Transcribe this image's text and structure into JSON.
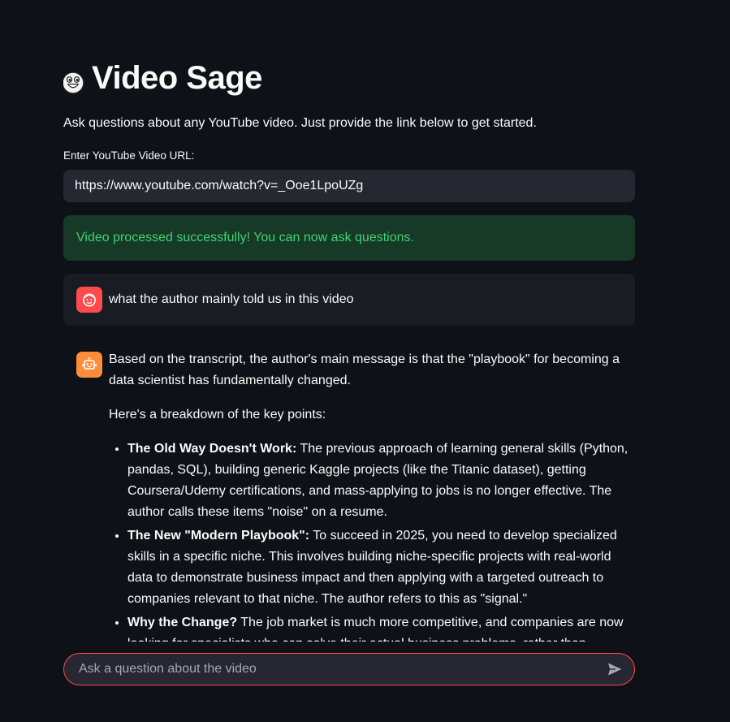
{
  "app": {
    "title": "Video Sage",
    "subtitle": "Ask questions about any YouTube video. Just provide the link below to get started."
  },
  "url_input": {
    "label": "Enter YouTube Video URL:",
    "value": "https://www.youtube.com/watch?v=_Ooe1LpoUZg"
  },
  "status": {
    "success_message": "Video processed successfully! You can now ask questions."
  },
  "chat": {
    "user_message": "what the author mainly told us in this video",
    "assistant": {
      "intro": "Based on the transcript, the author's main message is that the \"playbook\" for becoming a data scientist has fundamentally changed.",
      "breakdown_heading": "Here's a breakdown of the key points:",
      "points": [
        {
          "title": "The Old Way Doesn't Work:",
          "text": " The previous approach of learning general skills (Python, pandas, SQL), building generic Kaggle projects (like the Titanic dataset), getting Coursera/Udemy certifications, and mass-applying to jobs is no longer effective. The author calls these items \"noise\" on a resume."
        },
        {
          "title": "The New \"Modern Playbook\":",
          "text": " To succeed in 2025, you need to develop specialized skills in a specific niche. This involves building niche-specific projects with real-world data to demonstrate business impact and then applying with a targeted outreach to companies relevant to that niche. The author refers to this as \"signal.\""
        },
        {
          "title": "Why the Change?",
          "text": " The job market is much more competitive, and companies are now looking for specialists who can solve their actual business problems, rather than generalists with basic skills."
        }
      ]
    }
  },
  "chat_input": {
    "placeholder": "Ask a question about the video"
  },
  "icons": {
    "title_emoji": "grinning-face-icon",
    "user_avatar": "face-icon",
    "assistant_avatar": "robot-icon",
    "send": "send-icon"
  },
  "colors": {
    "background": "#0e1117",
    "input_background": "#262730",
    "success_background": "#173928",
    "success_text": "#3dd56d",
    "user_avatar": "#ff4b4b",
    "assistant_avatar": "#ff8c38",
    "focus_border": "#ff4b4b"
  }
}
